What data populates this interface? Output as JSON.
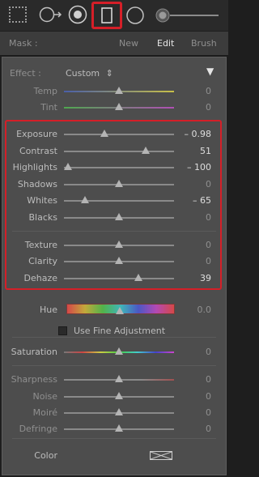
{
  "toolbar": {
    "tools": [
      {
        "name": "selection-grid-icon"
      },
      {
        "name": "circle-arrow-icon"
      },
      {
        "name": "radial-target-icon"
      },
      {
        "name": "rectangle-icon"
      },
      {
        "name": "circle-icon"
      },
      {
        "name": "brush-size-slider"
      }
    ],
    "selected_tool": "rectangle-icon",
    "highlight_color": "#d51f28"
  },
  "mask_nav": {
    "label": "Mask :",
    "new": "New",
    "edit": "Edit",
    "brush": "Brush"
  },
  "effect": {
    "label": "Effect :",
    "value": "Custom",
    "chevron": "⇕",
    "collapse_icon": "▼"
  },
  "temp": {
    "label": "Temp",
    "value": "0"
  },
  "tint": {
    "label": "Tint",
    "value": "0"
  },
  "sliders": [
    {
      "label": "Exposure",
      "value": "– 0.98",
      "level": 0.37
    },
    {
      "label": "Contrast",
      "value": "51",
      "level": 0.74
    },
    {
      "label": "Highlights",
      "value": "– 100",
      "level": 0.04
    },
    {
      "label": "Shadows",
      "value": "0",
      "level": 0.5
    },
    {
      "label": "Whites",
      "value": "– 65",
      "level": 0.19
    },
    {
      "label": "Blacks",
      "value": "0",
      "level": 0.5
    },
    {
      "label": "Texture",
      "value": "0",
      "level": 0.5
    },
    {
      "label": "Clarity",
      "value": "0",
      "level": 0.5
    },
    {
      "label": "Dehaze",
      "value": "39",
      "level": 0.68
    }
  ],
  "hue": {
    "label": "Hue",
    "value": "0.0"
  },
  "fine_adjustment": {
    "label": "Use Fine Adjustment"
  },
  "saturation": {
    "label": "Saturation",
    "value": "0"
  },
  "detail": [
    {
      "label": "Sharpness",
      "value": "0",
      "level": 0.5
    },
    {
      "label": "Noise",
      "value": "0",
      "level": 0.5
    },
    {
      "label": "Moiré",
      "value": "0",
      "level": 0.5
    },
    {
      "label": "Defringe",
      "value": "0",
      "level": 0.5
    }
  ],
  "color": {
    "label": "Color"
  }
}
